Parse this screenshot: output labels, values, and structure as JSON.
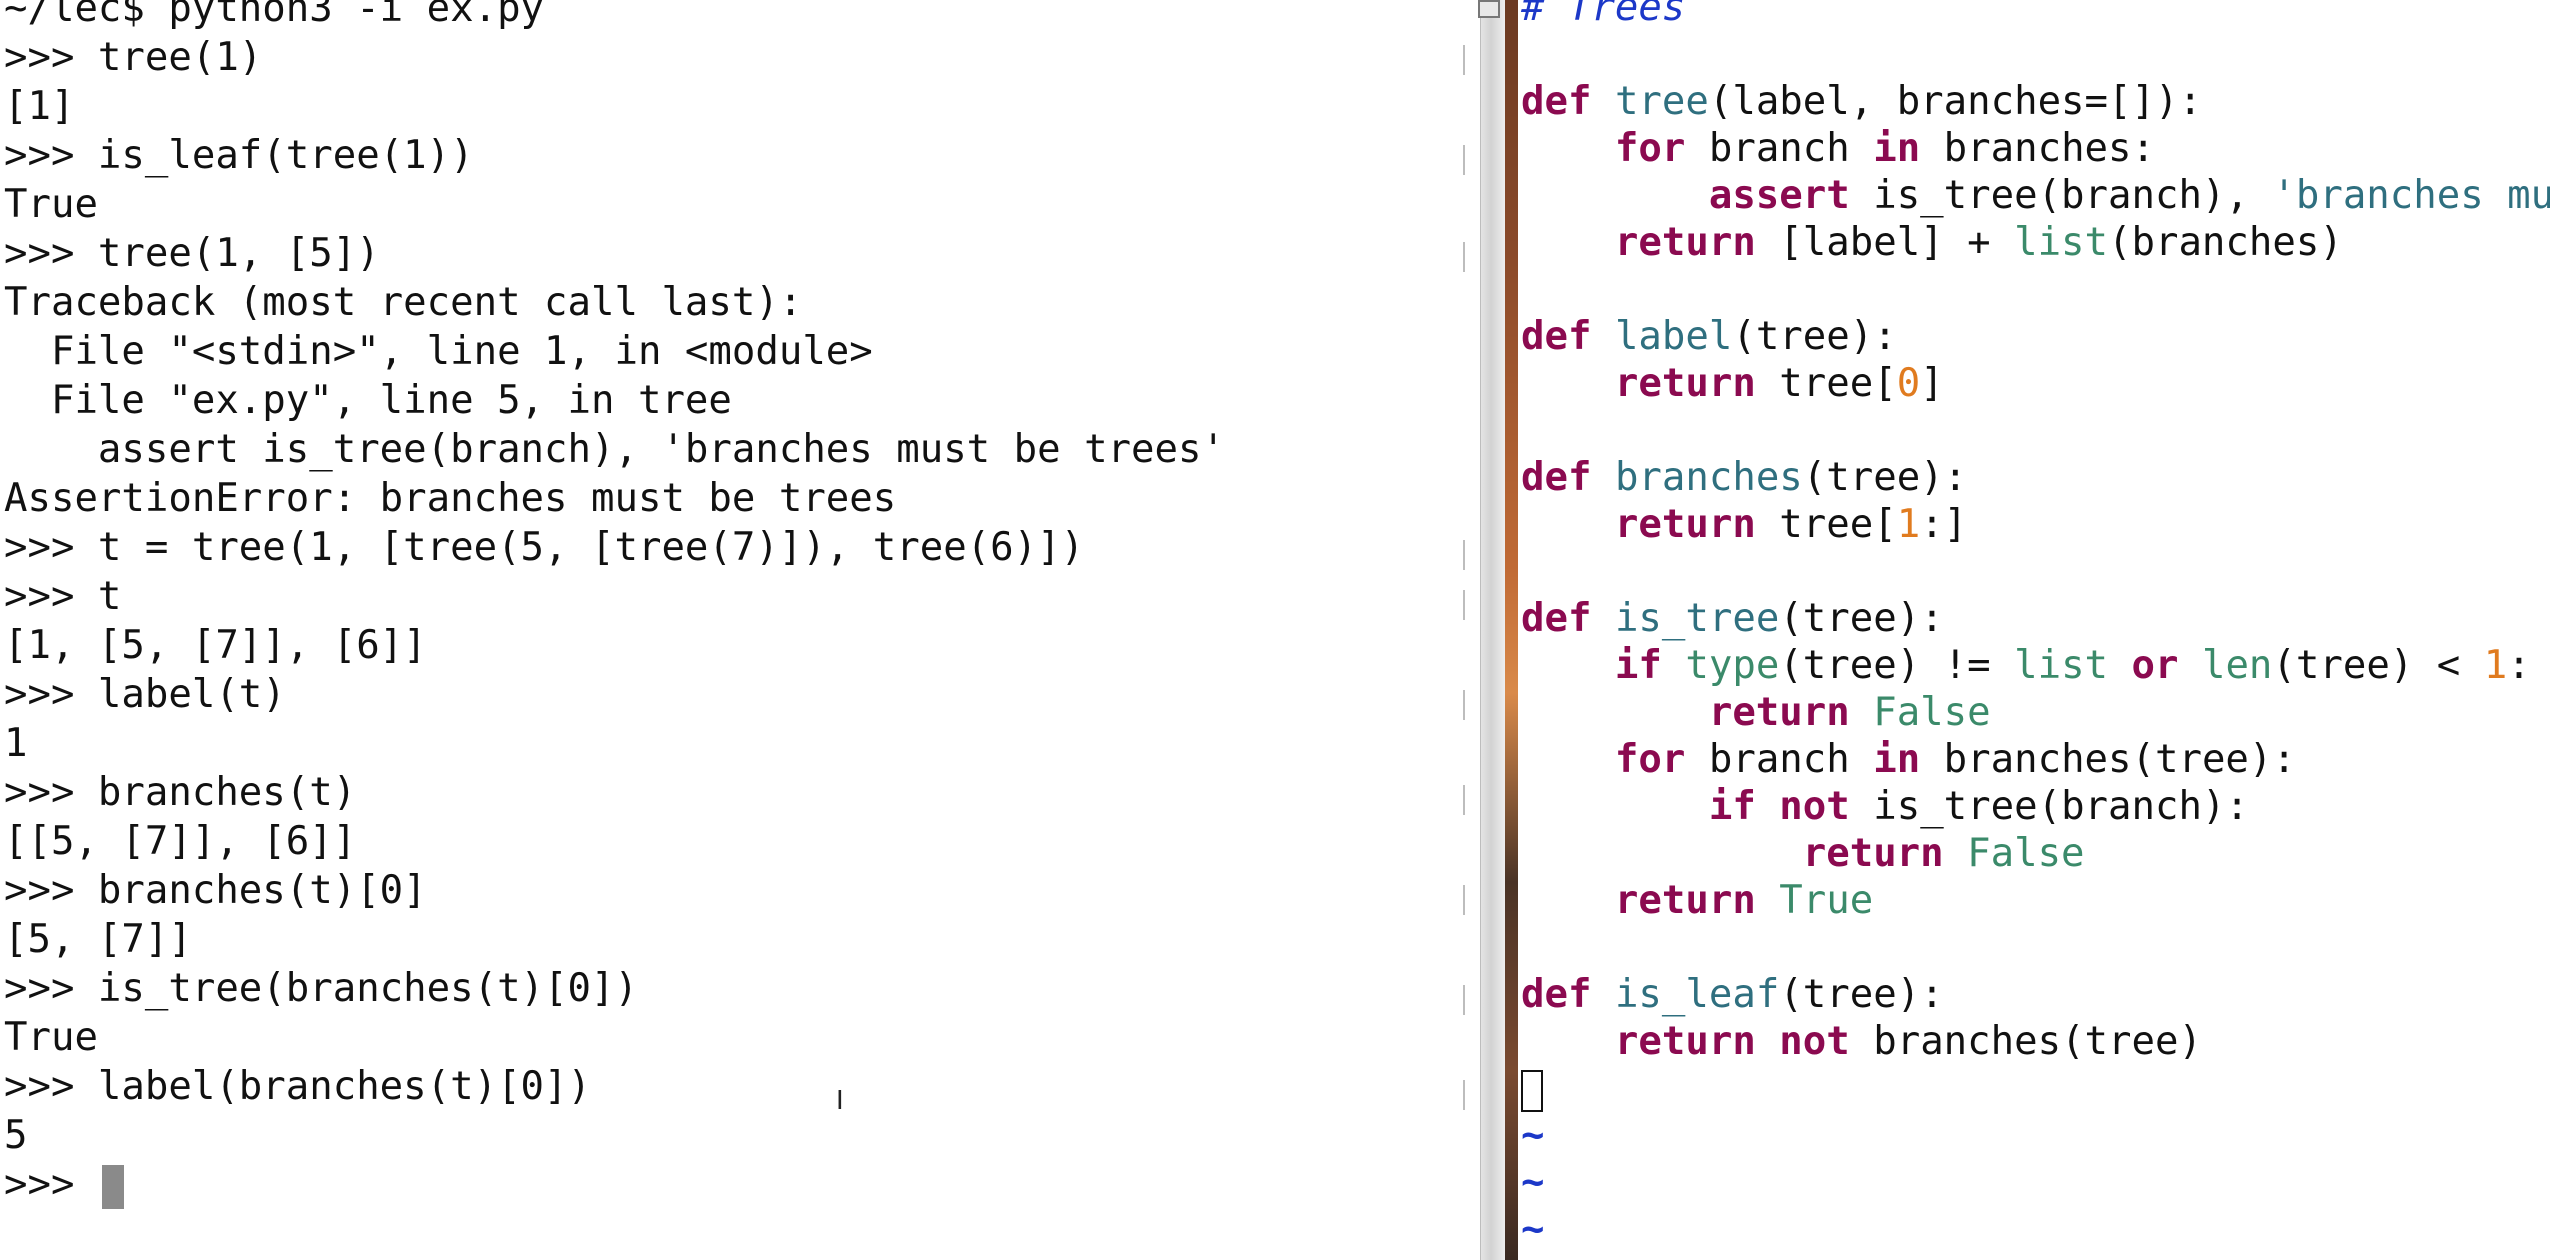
{
  "terminal": {
    "lines": [
      "~/lec$ python3 -i ex.py",
      ">>> tree(1)",
      "[1]",
      ">>> is_leaf(tree(1))",
      "True",
      ">>> tree(1, [5])",
      "Traceback (most recent call last):",
      "  File \"<stdin>\", line 1, in <module>",
      "  File \"ex.py\", line 5, in tree",
      "    assert is_tree(branch), 'branches must be trees'",
      "AssertionError: branches must be trees",
      ">>> t = tree(1, [tree(5, [tree(7)]), tree(6)])",
      ">>> t",
      "[1, [5, [7]], [6]]",
      ">>> label(t)",
      "1",
      ">>> branches(t)",
      "[[5, [7]], [6]]",
      ">>> branches(t)[0]",
      "[5, [7]]",
      ">>> is_tree(branches(t)[0])",
      "True",
      ">>> label(branches(t)[0])",
      "5"
    ],
    "prompt": ">>> ",
    "ibeam_glyph": "I"
  },
  "editor": {
    "comment": "# Trees",
    "lines": {
      "tree_def": [
        "def",
        " ",
        "tree",
        "(label, branches=[]):"
      ],
      "tree_for": [
        "    ",
        "for",
        " branch ",
        "in",
        " branches:"
      ],
      "tree_assert": [
        "        ",
        "assert",
        " is_tree(branch), ",
        "'branches mu"
      ],
      "tree_return": [
        "    ",
        "return",
        " [label] + ",
        "list",
        "(branches)"
      ],
      "label_def": [
        "def",
        " ",
        "label",
        "(tree):"
      ],
      "label_return": [
        "    ",
        "return",
        " tree[",
        "0",
        "]"
      ],
      "branches_def": [
        "def",
        " ",
        "branches",
        "(tree):"
      ],
      "branches_return": [
        "    ",
        "return",
        " tree[",
        "1",
        ":]"
      ],
      "istree_def": [
        "def",
        " ",
        "is_tree",
        "(tree):"
      ],
      "istree_if": [
        "    ",
        "if",
        " ",
        "type",
        "(tree) != ",
        "list",
        " ",
        "or",
        " ",
        "len",
        "(tree) < ",
        "1",
        ":"
      ],
      "istree_ret_false": [
        "        ",
        "return",
        " ",
        "False"
      ],
      "istree_for": [
        "    ",
        "for",
        " branch ",
        "in",
        " branches(tree):"
      ],
      "istree_ifnot": [
        "        ",
        "if",
        " ",
        "not",
        " is_tree(branch):"
      ],
      "istree_ret_false2": [
        "            ",
        "return",
        " ",
        "False"
      ],
      "istree_ret_true": [
        "    ",
        "return",
        " ",
        "True"
      ],
      "isleaf_def": [
        "def",
        " ",
        "is_leaf",
        "(tree):"
      ],
      "isleaf_return": [
        "    ",
        "return",
        " ",
        "not",
        " branches(tree)"
      ]
    },
    "tilde": "~"
  },
  "colors": {
    "keyword": "#8b0a50",
    "function_name": "#2f6f7f",
    "builtin": "#3b8a6a",
    "comment": "#1c38c8",
    "number": "#e07b1f"
  }
}
